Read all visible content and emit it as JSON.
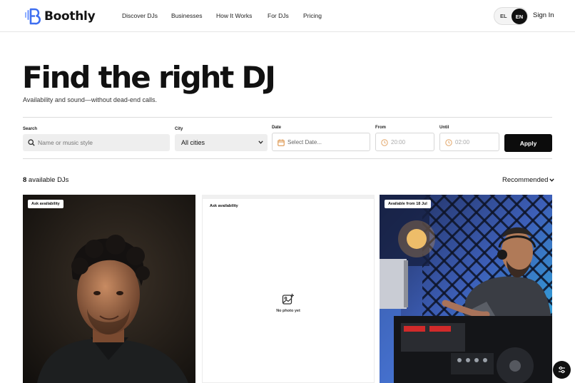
{
  "brand": {
    "name": "Boothly",
    "accent": "#3f6ff0"
  },
  "nav": {
    "items": [
      {
        "label": "Discover DJs"
      },
      {
        "label": "Businesses"
      },
      {
        "label": "How It Works"
      },
      {
        "label": "For DJs"
      },
      {
        "label": "Pricing"
      }
    ]
  },
  "lang": {
    "el": "EL",
    "en": "EN",
    "selected": "EN"
  },
  "auth": {
    "signin": "Sign In"
  },
  "hero": {
    "title": "Find the right DJ",
    "subtitle": "Availability and sound—without dead-end calls."
  },
  "filters": {
    "search": {
      "label": "Search",
      "placeholder": "Name or music style",
      "icon": "search-icon"
    },
    "city": {
      "label": "City",
      "value": "All cities"
    },
    "date": {
      "label": "Date",
      "placeholder": "Select Date...",
      "icon": "calendar-icon"
    },
    "from": {
      "label": "From",
      "placeholder": "20:00",
      "icon": "clock-icon"
    },
    "until": {
      "label": "Until",
      "placeholder": "02:00",
      "icon": "clock-icon"
    },
    "apply": "Apply"
  },
  "results": {
    "count": "8",
    "count_suffix": " available DJs",
    "sort": "Recommended"
  },
  "cards": [
    {
      "badge": "Ask availability",
      "photo": "portrait"
    },
    {
      "badge": "Ask availability",
      "empty_text": "No photo yet",
      "icon": "image-add-icon"
    },
    {
      "badge": "Available from 18 Jul",
      "photo": "dj-at-decks"
    }
  ],
  "fab": {
    "icon": "filter-sliders-icon"
  }
}
